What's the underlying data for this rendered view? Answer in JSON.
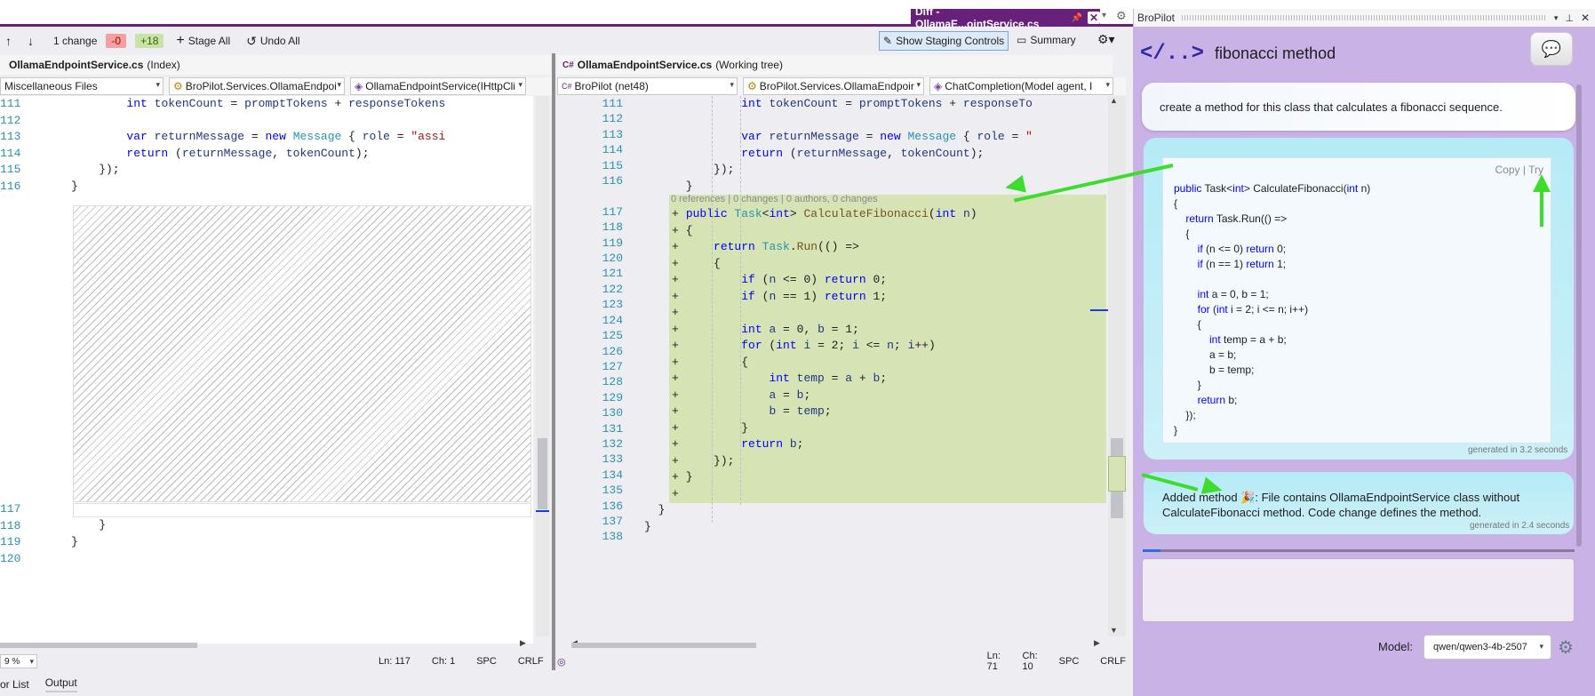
{
  "toolbar": {
    "up_arrow": "↑",
    "down_arrow": "↓",
    "change_count": "1 change",
    "removed": "-0",
    "added": "+18",
    "stage_all": "Stage All",
    "undo_all": "Undo All",
    "show_staging": "Show Staging Controls",
    "summary": "Summary"
  },
  "tab": {
    "label": "Diff - OllamaE...ointService.cs"
  },
  "left_pane": {
    "title": "OllamaEndpointService.cs",
    "title_suffix": "(Index)",
    "nav": [
      "Miscellaneous Files",
      "BroPilot.Services.OllamaEndpoi",
      "OllamaEndpointService(IHttpCli"
    ],
    "line_numbers_top": [
      "111",
      "112",
      "113",
      "114",
      "115",
      "116"
    ],
    "line_numbers_bottom": [
      "117",
      "118",
      "119",
      "120"
    ],
    "status": {
      "zoom": "9 %",
      "ln": "Ln: 117",
      "ch": "Ch: 1",
      "spc": "SPC",
      "crlf": "CRLF"
    }
  },
  "right_pane": {
    "title": "OllamaEndpointService.cs",
    "title_suffix": "(Working tree)",
    "nav": [
      "BroPilot (net48)",
      "BroPilot.Services.OllamaEndpoir",
      "ChatCompletion(Model agent, I"
    ],
    "codelens": "0 references | 0 changes | 0 authors, 0 changes",
    "line_numbers": [
      "111",
      "112",
      "113",
      "114",
      "115",
      "116",
      "117",
      "118",
      "119",
      "120",
      "121",
      "122",
      "123",
      "124",
      "125",
      "126",
      "127",
      "128",
      "129",
      "130",
      "131",
      "132",
      "133",
      "134",
      "135",
      "136",
      "137",
      "138"
    ],
    "status": {
      "ln": "Ln: 71",
      "ch": "Ch: 10",
      "spc": "SPC",
      "crlf": "CRLF"
    }
  },
  "bottom_tabs": [
    "or List",
    "Output"
  ],
  "bropilot": {
    "panel_title": "BroPilot",
    "logo": "</..>",
    "chat_title": "fibonacci method",
    "user_prompt": "create a method for this class that calculates a fibonacci sequence.",
    "copy": "Copy",
    "sep": "|",
    "try": "Try",
    "generated_1": "generated in 3.2 seconds",
    "result": "Added method 🎉: File contains OllamaEndpointService class without CalculateFibonacci method. Code change defines the method.",
    "generated_2": "generated in 2.4 seconds",
    "model_label": "Model:",
    "model_value": "qwen/qwen3-4b-2507"
  },
  "colors": {
    "accent": "#68217a",
    "diff_added": "#d6e3b5",
    "panel_bg": "#c9b2e6",
    "arrow": "#3ddc2d"
  }
}
